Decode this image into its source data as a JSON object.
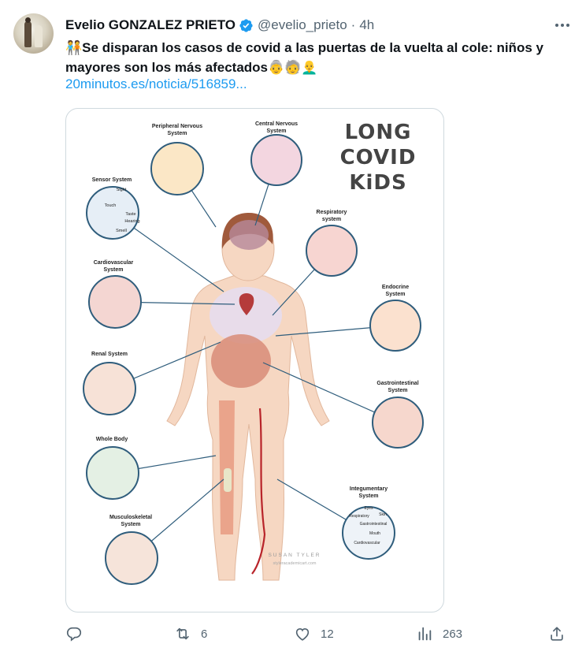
{
  "tweet": {
    "author_name": "Evelio GONZALEZ PRIETO",
    "handle": "@evelio_prieto",
    "separator": "·",
    "time": "4h",
    "text_lead_emoji": "🧑‍🤝‍🧑",
    "text": "Se disparan los casos de covid a las puertas de la vuelta al cole: niños y mayores son los más afectados",
    "text_trailing_emoji": "👵🧓👨‍🦲",
    "link": "20minutos.es/noticia/516859..."
  },
  "media": {
    "logo_lines": [
      "LONG",
      "COVID",
      "KiDS"
    ],
    "credit_name": "SUSAN TYLER",
    "credit_site": "styleracademicart.com",
    "labels": {
      "peripheral": [
        "Peripheral Nervous",
        "System"
      ],
      "central": [
        "Central Nervous",
        "System"
      ],
      "sensor": [
        "Sensor System"
      ],
      "sensor_items": [
        "Sight",
        "Touch",
        "Taste",
        "Hearing",
        "Smell"
      ],
      "respiratory": [
        "Respiratory",
        "system"
      ],
      "cardiovascular": [
        "Cardiovascular",
        "System"
      ],
      "endocrine": [
        "Endocrine",
        "System"
      ],
      "renal": [
        "Renal System"
      ],
      "gastro": [
        "Gastrointestinal",
        "System"
      ],
      "whole": [
        "Whole Body"
      ],
      "integumentary": [
        "Integumentary",
        "System"
      ],
      "integ_items": [
        "Eyes",
        "Respiratory",
        "Skin",
        "Gastrointestinal",
        "Mouth",
        "Cardiovascular"
      ],
      "musculo": [
        "Musculoskeletal",
        "System"
      ]
    }
  },
  "actions": {
    "reply_count": "",
    "retweet_count": "6",
    "like_count": "12",
    "views_count": "263"
  },
  "colors": {
    "link": "#1d9bf0",
    "secondary_text": "#536471",
    "verified": "#1d9bf0",
    "border": "#cfd9de",
    "circle_stroke": "#2f5d7c"
  }
}
